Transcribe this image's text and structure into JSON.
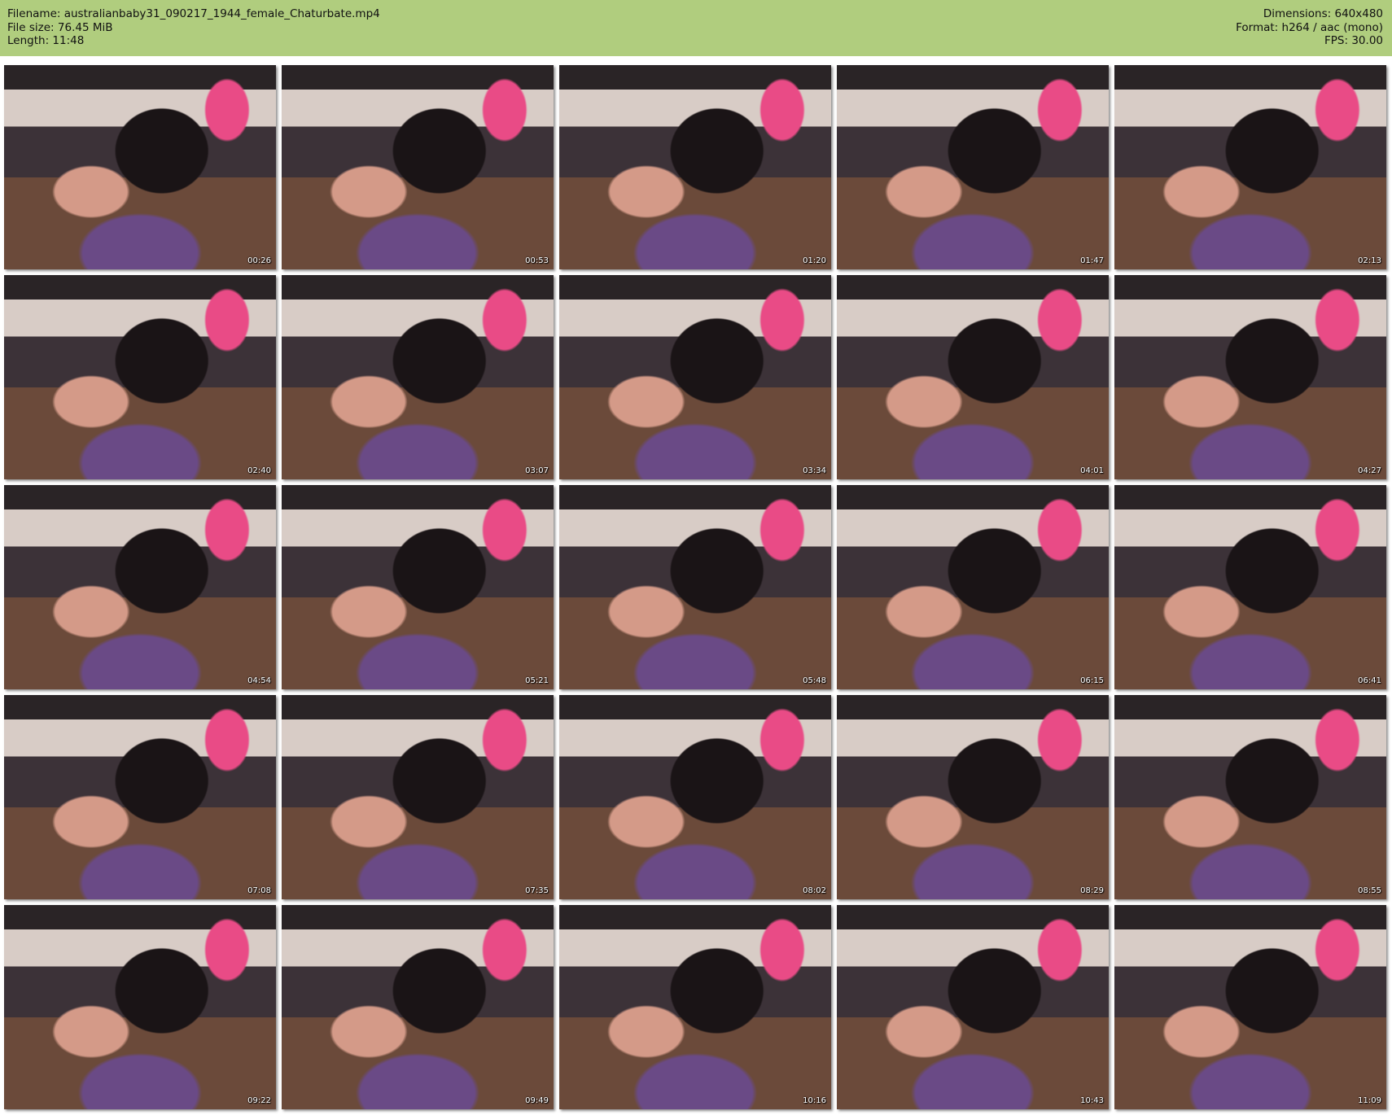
{
  "header": {
    "filename": "Filename: australianbaby31_090217_1944_female_Chaturbate.mp4",
    "file_size": "File size: 76.45 MiB",
    "length": "Length: 11:48",
    "dimensions": "Dimensions: 640x480",
    "format": "Format: h264 / aac (mono)",
    "fps": "FPS: 30.00"
  },
  "thumbnails": [
    "00:26",
    "00:53",
    "01:20",
    "01:47",
    "02:13",
    "02:40",
    "03:07",
    "03:34",
    "04:01",
    "04:27",
    "04:54",
    "05:21",
    "05:48",
    "06:15",
    "06:41",
    "07:08",
    "07:35",
    "08:02",
    "08:29",
    "08:55",
    "09:22",
    "09:49",
    "10:16",
    "10:43",
    "11:09"
  ],
  "colors": {
    "header_bg": "#b0cd7e"
  }
}
